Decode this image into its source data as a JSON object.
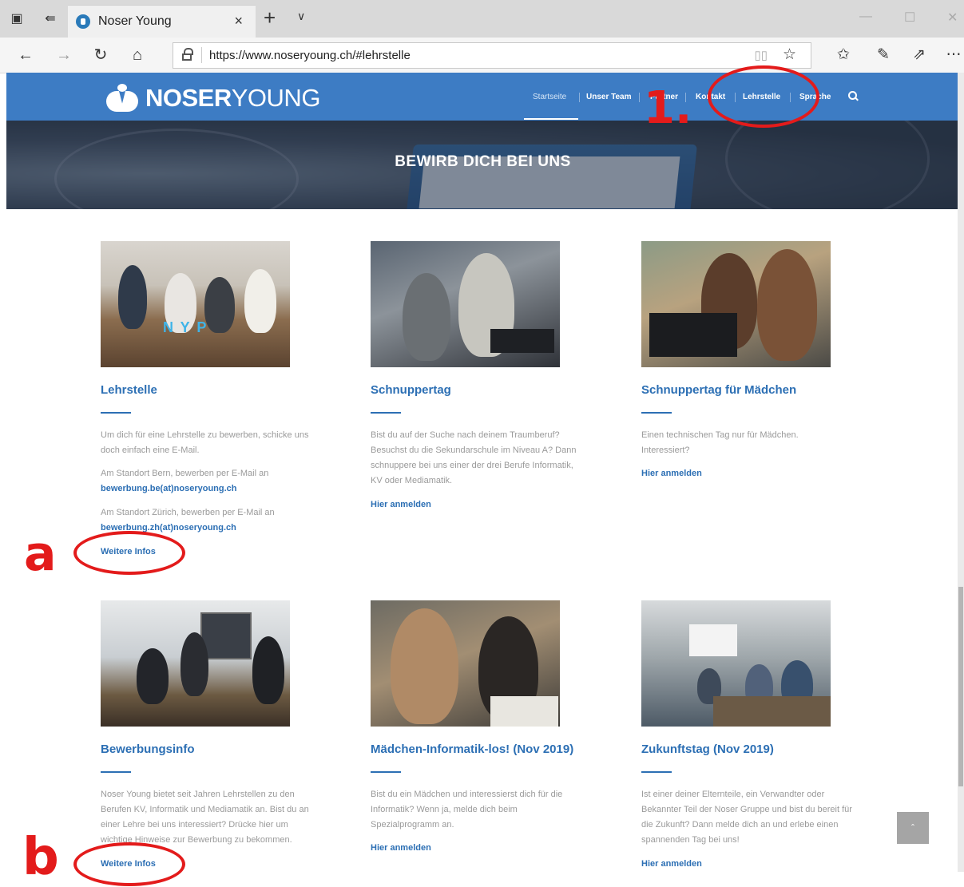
{
  "browser": {
    "tab_title": "Noser Young",
    "tab_close": "×",
    "new_tab": "+",
    "tab_menu": "∨",
    "url": "https://www.noseryoung.ch/#lehrstelle",
    "icons": [
      "tab-preview-icon",
      "set-aside-tabs-icon",
      "back-icon",
      "forward-icon",
      "refresh-icon",
      "home-icon",
      "lock-icon",
      "reading-view-icon",
      "favorite-star-icon",
      "favorites-icon",
      "pen-icon",
      "share-icon",
      "more-icon"
    ]
  },
  "site": {
    "logo_bold": "NOSER",
    "logo_light": "YOUNG",
    "menu": [
      {
        "label": "Startseite"
      },
      {
        "label": "Unser Team"
      },
      {
        "label": "Partner"
      },
      {
        "label": "Kontakt"
      },
      {
        "label": "Lehrstelle"
      },
      {
        "label": "Sprache"
      }
    ],
    "hero_title": "BEWIRB DICH BEI UNS",
    "accent_color": "#3d7cc4"
  },
  "cards": [
    {
      "title": "Lehrstelle",
      "p1": "Um dich für eine Lehrstelle zu bewerben, schicke uns doch einfach eine E-Mail.",
      "p2_prefix": "Am Standort Bern, bewerben per E-Mail an ",
      "p2_email": "bewerbung.be(at)noseryoung.ch",
      "p3_prefix": "Am Standort Zürich, bewerben per E-Mail an ",
      "p3_email": "bewerbung.zh(at)noseryoung.ch",
      "link": "Weitere Infos"
    },
    {
      "title": "Schnuppertag",
      "p1": "Bist du auf der Suche nach deinem Traumberuf? Besuchst du die Sekundarschule im Niveau A? Dann schnuppere bei uns einer der drei Berufe Informatik, KV oder Mediamatik.",
      "link": "Hier anmelden"
    },
    {
      "title": "Schnuppertag für Mädchen",
      "p1": "Einen technischen Tag nur für Mädchen. Interessiert?",
      "link": "Hier anmelden"
    },
    {
      "title": "Bewerbungsinfo",
      "p1": "Noser Young bietet seit Jahren Lehrstellen zu den Berufen KV, Informatik und Mediamatik an. Bist du an einer Lehre bei uns interessiert? Drücke hier um wichtige Hinweise zur Bewerbung zu bekommen.",
      "link": "Weitere Infos"
    },
    {
      "title": "Mädchen-Informatik-los! (Nov 2019)",
      "p1": "Bist du ein Mädchen und interessierst dich für die Informatik? Wenn ja, melde dich beim Spezialprogramm an.",
      "link": "Hier anmelden"
    },
    {
      "title": "Zukunftstag (Nov 2019)",
      "p1": "Ist einer deiner Elternteile, ein Verwandter oder Bekannter Teil der Noser Gruppe und bist du bereit für die Zukunft? Dann melde dich an und erlebe einen spannenden Tag bei uns!",
      "link": "Hier anmelden"
    }
  ],
  "photo_text": "N Y P",
  "annotations": {
    "step1": "1.",
    "a": "a",
    "b": "b",
    "color": "#e31b1b"
  },
  "back_to_top": "ˆ"
}
